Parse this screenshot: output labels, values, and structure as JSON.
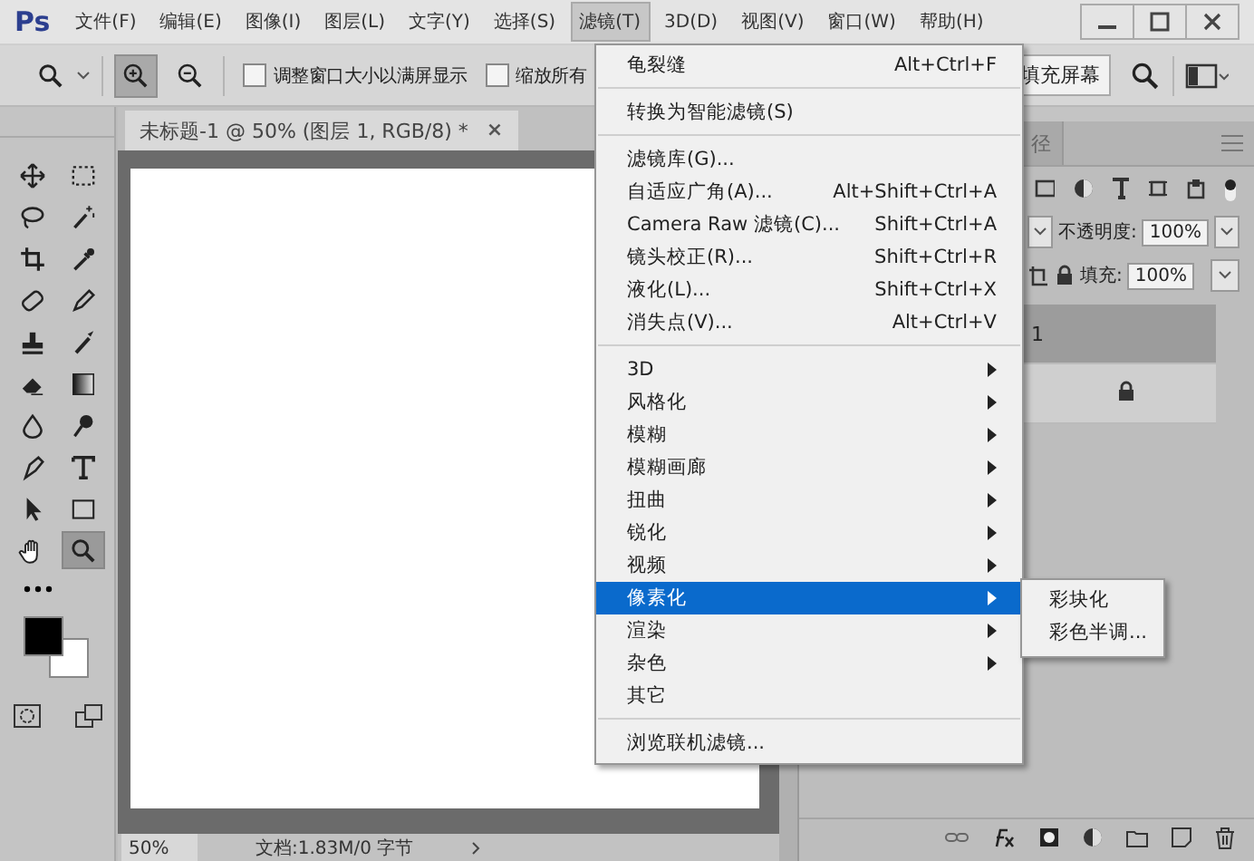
{
  "app_logo": "Ps",
  "menu_bar": [
    {
      "label": "文件(F)",
      "selected": false
    },
    {
      "label": "编辑(E)",
      "selected": false
    },
    {
      "label": "图像(I)",
      "selected": false
    },
    {
      "label": "图层(L)",
      "selected": false
    },
    {
      "label": "文字(Y)",
      "selected": false
    },
    {
      "label": "选择(S)",
      "selected": false
    },
    {
      "label": "滤镜(T)",
      "selected": true
    },
    {
      "label": "3D(D)",
      "selected": false
    },
    {
      "label": "视图(V)",
      "selected": false
    },
    {
      "label": "窗口(W)",
      "selected": false
    },
    {
      "label": "帮助(H)",
      "selected": false
    }
  ],
  "options_bar": {
    "tool_buttons": [
      {
        "kind": "zoom-in",
        "selected": true
      },
      {
        "kind": "zoom-out",
        "selected": false
      }
    ],
    "checkboxes": [
      {
        "label": "调整窗口大小以满屏显示",
        "checked": false
      },
      {
        "label": "缩放所有",
        "checked": false
      }
    ],
    "fill_screen_button": "填充屏幕"
  },
  "document_tab": {
    "title": "未标题-1 @ 50% (图层 1, RGB/8) *",
    "close": "×"
  },
  "toolbox": [
    {
      "kind": "move",
      "selected": false
    },
    {
      "kind": "marquee",
      "selected": false
    },
    {
      "kind": "lasso",
      "selected": false
    },
    {
      "kind": "wand",
      "selected": false
    },
    {
      "kind": "crop",
      "selected": false
    },
    {
      "kind": "eyedropper",
      "selected": false
    },
    {
      "kind": "bandage",
      "selected": false
    },
    {
      "kind": "pencil",
      "selected": false
    },
    {
      "kind": "stamp",
      "selected": false
    },
    {
      "kind": "brush",
      "selected": false
    },
    {
      "kind": "eraser",
      "selected": false
    },
    {
      "kind": "gradient",
      "selected": false
    },
    {
      "kind": "drop",
      "selected": false
    },
    {
      "kind": "dodge",
      "selected": false
    },
    {
      "kind": "pen",
      "selected": false
    },
    {
      "kind": "type",
      "selected": false
    },
    {
      "kind": "arrow",
      "selected": false
    },
    {
      "kind": "rectangle",
      "selected": false
    },
    {
      "kind": "hand",
      "selected": false
    },
    {
      "kind": "zoom",
      "selected": true
    }
  ],
  "status_bar": {
    "zoom": "50%",
    "doc_info": "文档:1.83M/0 字节"
  },
  "filter_menu": [
    {
      "kind": "item",
      "label": "龟裂缝",
      "shortcut": "Alt+Ctrl+F",
      "selected": false
    },
    {
      "kind": "separator"
    },
    {
      "kind": "item",
      "label": "转换为智能滤镜(S)",
      "selected": false
    },
    {
      "kind": "separator"
    },
    {
      "kind": "item",
      "label": "滤镜库(G)...",
      "selected": false
    },
    {
      "kind": "item",
      "label": "自适应广角(A)...",
      "shortcut": "Alt+Shift+Ctrl+A",
      "selected": false
    },
    {
      "kind": "item",
      "label": "Camera Raw 滤镜(C)...",
      "shortcut": "Shift+Ctrl+A",
      "selected": false
    },
    {
      "kind": "item",
      "label": "镜头校正(R)...",
      "shortcut": "Shift+Ctrl+R",
      "selected": false
    },
    {
      "kind": "item",
      "label": "液化(L)...",
      "shortcut": "Shift+Ctrl+X",
      "selected": false
    },
    {
      "kind": "item",
      "label": "消失点(V)...",
      "shortcut": "Alt+Ctrl+V",
      "selected": false
    },
    {
      "kind": "separator"
    },
    {
      "kind": "submenu",
      "label": "3D",
      "selected": false
    },
    {
      "kind": "submenu",
      "label": "风格化",
      "selected": false
    },
    {
      "kind": "submenu",
      "label": "模糊",
      "selected": false
    },
    {
      "kind": "submenu",
      "label": "模糊画廊",
      "selected": false
    },
    {
      "kind": "submenu",
      "label": "扭曲",
      "selected": false
    },
    {
      "kind": "submenu",
      "label": "锐化",
      "selected": false
    },
    {
      "kind": "submenu",
      "label": "视频",
      "selected": false
    },
    {
      "kind": "submenu",
      "label": "像素化",
      "selected": true
    },
    {
      "kind": "submenu",
      "label": "渲染",
      "selected": false
    },
    {
      "kind": "submenu",
      "label": "杂色",
      "selected": false
    },
    {
      "kind": "item",
      "label": "其它",
      "selected": false
    },
    {
      "kind": "separator"
    },
    {
      "kind": "item",
      "label": "浏览联机滤镜...",
      "selected": false
    }
  ],
  "submenu": [
    "彩块化",
    "彩色半调..."
  ],
  "layers_panel": {
    "tab": "径",
    "opacity_label": "不透明度:",
    "opacity": "100%",
    "fill_label": "填充:",
    "fill": "100%",
    "layers": [
      {
        "name": "1",
        "selected": true,
        "locked": false
      },
      {
        "selected": false,
        "locked": true
      }
    ]
  }
}
